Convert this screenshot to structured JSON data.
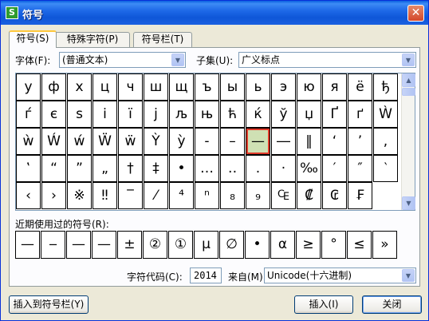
{
  "window": {
    "title": "符号",
    "app_icon_glyph": "S"
  },
  "tabs": [
    {
      "label": "符号(S)",
      "active": true
    },
    {
      "label": "特殊字符(P)",
      "active": false
    },
    {
      "label": "符号栏(T)",
      "active": false
    }
  ],
  "font": {
    "label": "字体(F):",
    "value": "(普通文本)"
  },
  "subset": {
    "label": "子集(U):",
    "value": "广义标点"
  },
  "symbols": [
    [
      "у",
      "ф",
      "х",
      "ц",
      "ч",
      "ш",
      "щ",
      "ъ",
      "ы",
      "ь",
      "э",
      "ю",
      "я",
      "ё",
      "ђ"
    ],
    [
      "ѓ",
      "є",
      "s",
      "і",
      "ї",
      "j",
      "љ",
      "њ",
      "ћ",
      "ќ",
      "ў",
      "џ",
      "Ґ",
      "ґ",
      "Ẁ"
    ],
    [
      "ẁ",
      "Ẃ",
      "ẃ",
      "Ẅ",
      "ẅ",
      "Ỳ",
      "ỳ",
      "-",
      "–",
      "—",
      "―",
      "‖",
      "‘",
      "’",
      ","
    ],
    [
      "‛",
      "“",
      "”",
      "„",
      "†",
      "‡",
      "•",
      "…",
      "‥",
      "․",
      "·",
      "‰",
      "′",
      "″",
      "‵"
    ],
    [
      "‹",
      "›",
      "※",
      "‼",
      "‾",
      "⁄",
      "⁴",
      "ⁿ",
      "₈",
      "₉",
      "₠",
      "₡",
      "₢",
      "₣"
    ]
  ],
  "recent": {
    "label": "近期使用过的符号(R):",
    "items": [
      "—",
      "‒",
      "—",
      "—",
      "±",
      "②",
      "①",
      "μ",
      "∅",
      "•",
      "α",
      "≥",
      "°",
      "≤",
      "»"
    ]
  },
  "code": {
    "label": "字符代码(C):",
    "value": "2014",
    "from_label": "来自(M)",
    "from_value": "Unicode(十六进制)"
  },
  "buttons": {
    "insert_to_bar": "插入到符号栏(Y)",
    "insert": "插入(I)",
    "close": "关闭"
  },
  "colors": {
    "titlebar": "#0e56d8",
    "selected_cell": "#cfe0b4",
    "selected_outline": "#e03a2a"
  }
}
